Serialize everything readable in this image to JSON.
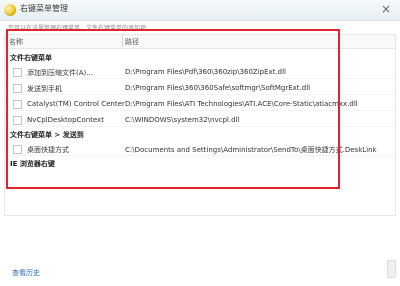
{
  "window": {
    "title": "右键菜单管理",
    "close_glyph": "×",
    "icon_name": "app-icon"
  },
  "hint": "您可以在这里管理右键菜单，文件右键菜单的添加项",
  "table": {
    "headers": {
      "name": "名称",
      "path": "路径"
    },
    "groups": [
      {
        "label": "文件右键菜单",
        "rows": [
          {
            "name": "添加到压缩文件(A)...",
            "path": "D:\\Program Files\\Pdf\\360\\360zip\\360ZipExt.dll"
          },
          {
            "name": "发送到手机",
            "path": "D:\\Program Files\\360\\360Safe\\softmgr\\SoftMgrExt.dll"
          },
          {
            "name": "Catalyst(TM) Control Center",
            "path": "D:\\Program Files\\ATI Technologies\\ATI.ACE\\Core-Static\\atiacmxx.dll"
          },
          {
            "name": "NvCplDesktopContext",
            "path": "C:\\WINDOWS\\system32\\nvcpl.dll"
          }
        ]
      },
      {
        "label": "文件右键菜单 > 发送到",
        "rows": [
          {
            "name": "桌面快捷方式",
            "path": "C:\\Documents and Settings\\Administrator\\SendTo\\桌面快捷方式.DeskLink"
          }
        ]
      },
      {
        "label": "IE 浏览器右键",
        "rows": []
      }
    ]
  },
  "footer": {
    "history_link": "查看历史"
  },
  "colors": {
    "highlight_border": "#e0242c",
    "link": "#2b6cb0"
  }
}
